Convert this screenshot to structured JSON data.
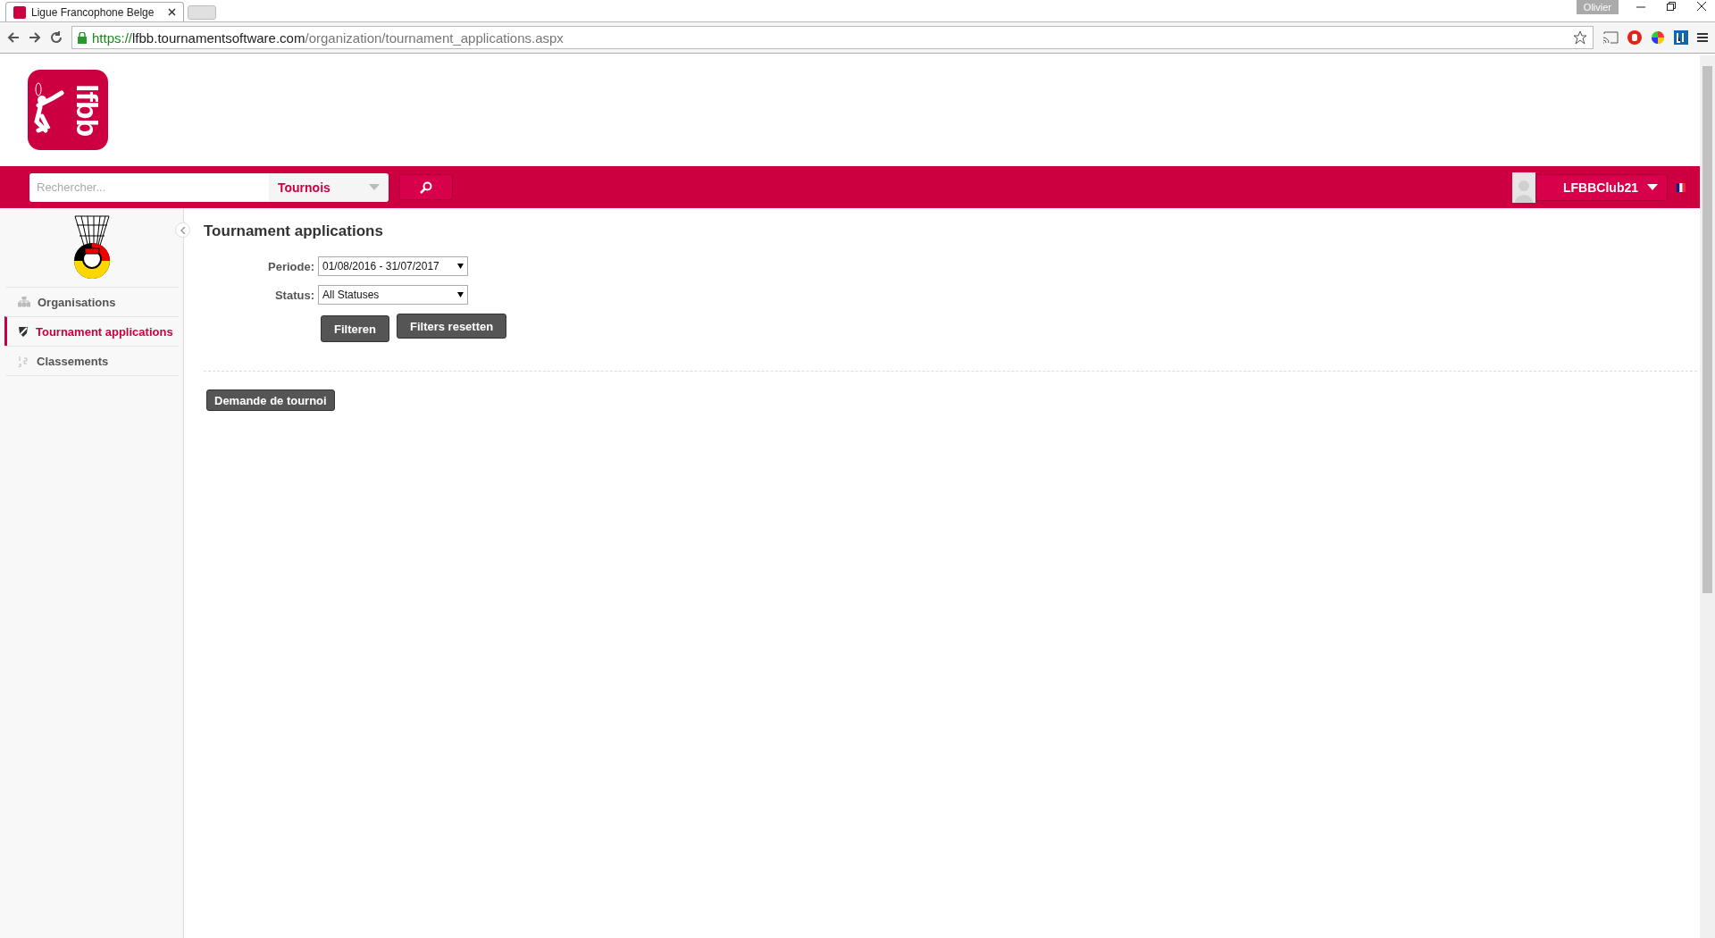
{
  "browser": {
    "tab_title": "Ligue Francophone Belge",
    "profile": "Olivier",
    "url": {
      "scheme": "https://",
      "host": "lfbb.tournamentsoftware.com",
      "path": "/organization/tournament_applications.aspx"
    }
  },
  "header": {
    "logo_text": "lfbb",
    "search": {
      "placeholder": "Rechercher..."
    },
    "category": "Tournois",
    "user": "LFBBClub21"
  },
  "sidebar": {
    "items": [
      {
        "label": "Organisations",
        "kind": "org",
        "selected": false
      },
      {
        "label": "Tournament applications",
        "kind": "shield",
        "selected": true
      },
      {
        "label": "Classements",
        "kind": "rank",
        "selected": false
      }
    ]
  },
  "page": {
    "title": "Tournament applications",
    "filters": [
      {
        "label": "Periode:",
        "value": "01/08/2016 - 31/07/2017"
      },
      {
        "label": "Status:",
        "value": "All Statuses"
      }
    ],
    "buttons": [
      "Filteren",
      "Filters resetten"
    ],
    "action": "Demande de tournoi"
  }
}
